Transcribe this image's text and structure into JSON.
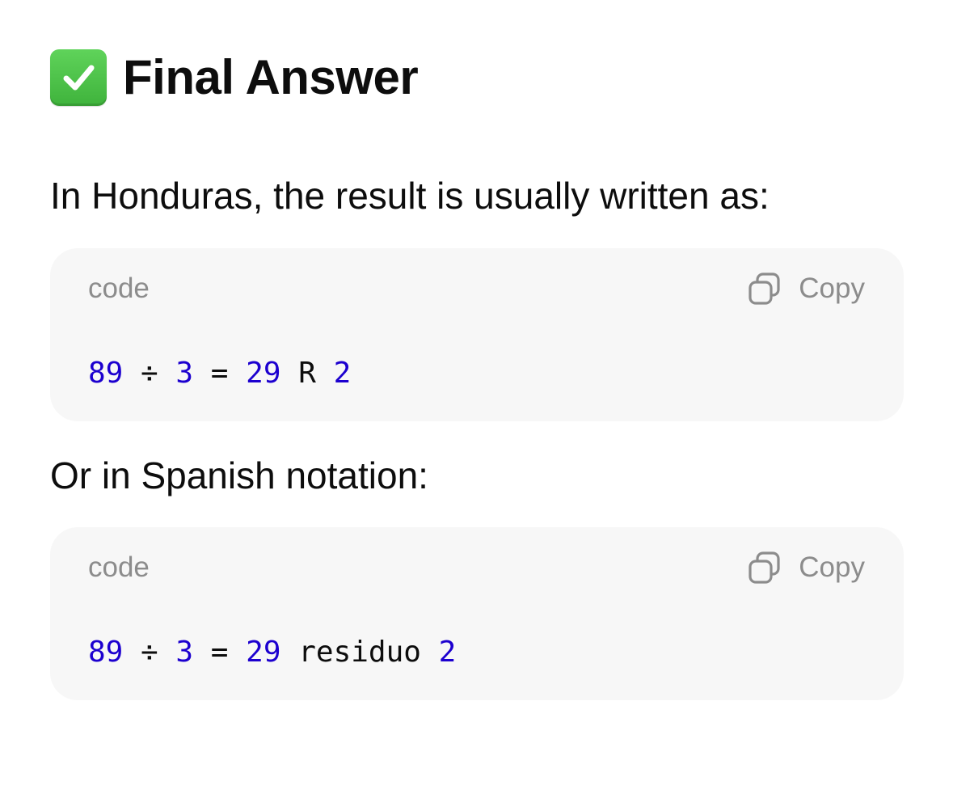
{
  "heading": {
    "icon": "check-mark-button-icon",
    "title": "Final Answer"
  },
  "paragraphs": {
    "intro": "In Honduras, the result is usually written as:",
    "spanish": "Or in Spanish notation:"
  },
  "code_blocks": [
    {
      "language": "code",
      "copy_label": "Copy",
      "tokens": [
        {
          "text": "89",
          "kind": "num"
        },
        {
          "text": " ",
          "kind": "space"
        },
        {
          "text": "÷",
          "kind": "op"
        },
        {
          "text": " ",
          "kind": "space"
        },
        {
          "text": "3",
          "kind": "num"
        },
        {
          "text": " ",
          "kind": "space"
        },
        {
          "text": "=",
          "kind": "op"
        },
        {
          "text": " ",
          "kind": "space"
        },
        {
          "text": "29",
          "kind": "num"
        },
        {
          "text": " ",
          "kind": "space"
        },
        {
          "text": "R",
          "kind": "id"
        },
        {
          "text": " ",
          "kind": "space"
        },
        {
          "text": "2",
          "kind": "num"
        }
      ]
    },
    {
      "language": "code",
      "copy_label": "Copy",
      "tokens": [
        {
          "text": "89",
          "kind": "num"
        },
        {
          "text": " ",
          "kind": "space"
        },
        {
          "text": "÷",
          "kind": "op"
        },
        {
          "text": " ",
          "kind": "space"
        },
        {
          "text": "3",
          "kind": "num"
        },
        {
          "text": " ",
          "kind": "space"
        },
        {
          "text": "=",
          "kind": "op"
        },
        {
          "text": " ",
          "kind": "space"
        },
        {
          "text": "29",
          "kind": "num"
        },
        {
          "text": " ",
          "kind": "space"
        },
        {
          "text": "residuo",
          "kind": "id"
        },
        {
          "text": " ",
          "kind": "space"
        },
        {
          "text": "2",
          "kind": "num"
        }
      ]
    }
  ],
  "colors": {
    "number_token": "#1c00cf",
    "text": "#0d0d0d",
    "muted": "#8c8c8c",
    "code_background": "#f7f7f7",
    "check_green": "#4cc14a"
  }
}
